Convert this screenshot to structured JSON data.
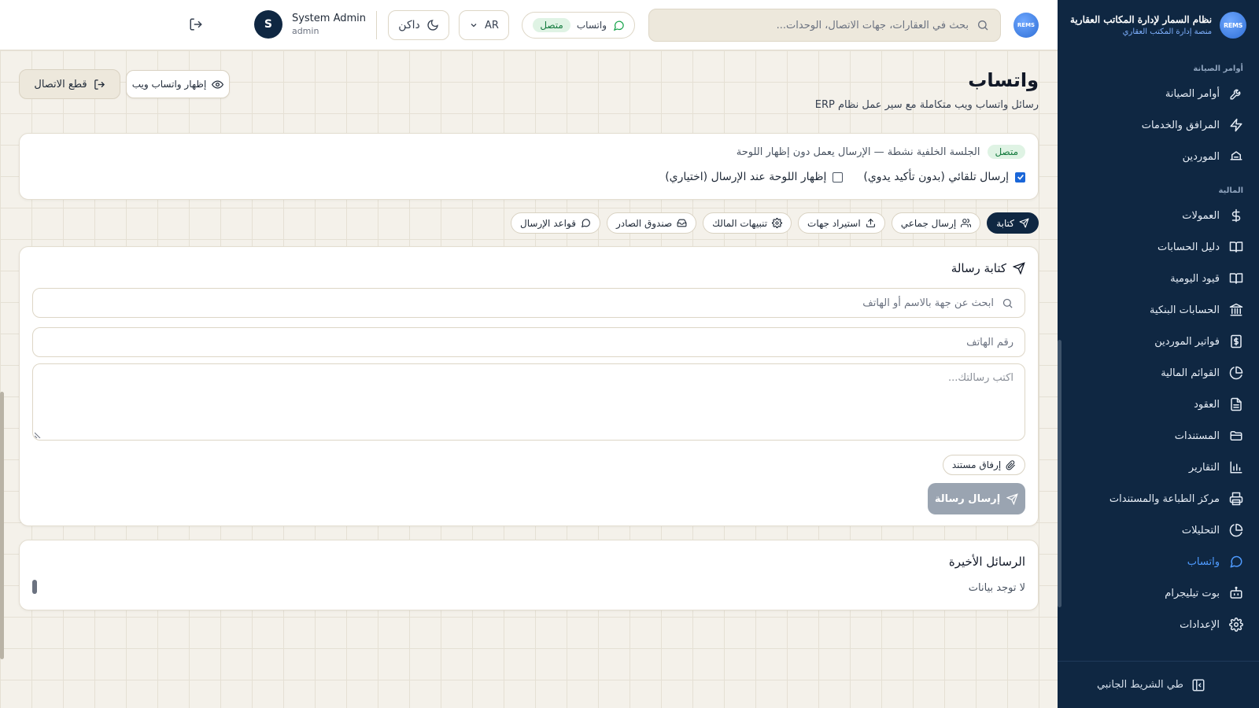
{
  "brand": {
    "logo_text": "REMS",
    "title": "نظام السمار لإدارة المكاتب العقارية",
    "subtitle": "منصة إدارة المكتب العقاري"
  },
  "sidebar": {
    "sections": [
      {
        "title": "أوامر الصيانة",
        "items": [
          {
            "label": "أوامر الصيانة",
            "icon": "wrench-icon"
          },
          {
            "label": "المرافق والخدمات",
            "icon": "bolt-icon"
          },
          {
            "label": "الموردين",
            "icon": "truck-icon"
          }
        ]
      },
      {
        "title": "المالية",
        "items": [
          {
            "label": "العمولات",
            "icon": "dollar-icon"
          },
          {
            "label": "دليل الحسابات",
            "icon": "book-icon"
          },
          {
            "label": "قيود اليومية",
            "icon": "book-open-icon"
          },
          {
            "label": "الحسابات البنكية",
            "icon": "bank-icon"
          },
          {
            "label": "فواتير الموردين",
            "icon": "invoice-icon"
          },
          {
            "label": "القوائم المالية",
            "icon": "pie-chart-icon"
          },
          {
            "label": "العقود",
            "icon": "file-icon"
          },
          {
            "label": "المستندات",
            "icon": "folder-icon"
          },
          {
            "label": "التقارير",
            "icon": "bar-chart-icon"
          },
          {
            "label": "مركز الطباعة والمستندات",
            "icon": "printer-icon"
          },
          {
            "label": "التحليلات",
            "icon": "analytics-icon"
          },
          {
            "label": "واتساب",
            "icon": "chat-icon",
            "active": true
          },
          {
            "label": "بوت تيليجرام",
            "icon": "bot-icon"
          },
          {
            "label": "الإعدادات",
            "icon": "gear-icon"
          }
        ]
      }
    ],
    "collapse_label": "طي الشريط الجانبي"
  },
  "header": {
    "logo_text": "REMS",
    "search_placeholder": "بحث في العقارات، جهات الاتصال، الوحدات...",
    "whatsapp_label": "واتساب",
    "whatsapp_status": "متصل",
    "language": "AR",
    "theme_label": "داكن",
    "user_name": "System Admin",
    "user_role": "admin",
    "user_initial": "S"
  },
  "page": {
    "title": "واتساب",
    "subtitle": "رسائل واتساب ويب متكاملة مع سير عمل نظام ERP",
    "disconnect_label": "قطع الاتصال",
    "show_web_label": "إظهار واتساب ويب"
  },
  "status": {
    "badge": "متصل",
    "message": "الجلسة الخلفية نشطة — الإرسال يعمل دون إظهار اللوحة",
    "auto_send_label": "إرسال تلقائي (بدون تأكيد يدوي)",
    "auto_send_checked": true,
    "show_panel_label": "إظهار اللوحة عند الإرسال (اختياري)",
    "show_panel_checked": false
  },
  "tabs": [
    {
      "label": "كتابة",
      "icon": "send-icon",
      "active": true
    },
    {
      "label": "إرسال جماعي",
      "icon": "users-icon"
    },
    {
      "label": "استيراد جهات",
      "icon": "upload-icon"
    },
    {
      "label": "تنبيهات المالك",
      "icon": "gear-icon"
    },
    {
      "label": "صندوق الصادر",
      "icon": "inbox-icon"
    },
    {
      "label": "قواعد الإرسال",
      "icon": "chat-icon"
    }
  ],
  "compose": {
    "title": "كتابة رسالة",
    "contact_search_placeholder": "ابحث عن جهة بالاسم أو الهاتف",
    "phone_placeholder": "رقم الهاتف",
    "message_placeholder": "اكتب رسالتك...",
    "attach_label": "إرفاق مستند",
    "send_label": "إرسال رسالة"
  },
  "recent": {
    "title": "الرسائل الأخيرة",
    "empty_text": "لا توجد بيانات"
  }
}
